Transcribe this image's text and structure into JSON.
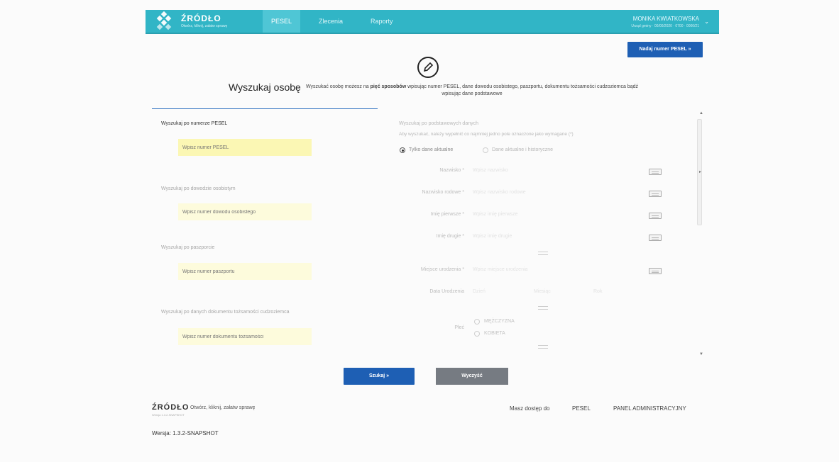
{
  "header": {
    "logo_title": "ŹRÓDŁO",
    "logo_subtitle": "Otwórz, kliknij, załatw sprawę",
    "nav": [
      {
        "label": "PESEL",
        "active": true
      },
      {
        "label": "Zlecenia",
        "active": false
      },
      {
        "label": "Raporty",
        "active": false
      }
    ],
    "user_name": "MONIKA KWIATKOWSKA",
    "user_sub": "Urząd gminy · 00/00/2020 · 0700 · 0000/21"
  },
  "assign_pesel_button": "Nadaj numer PESEL »",
  "search": {
    "title": "Wyszukaj osobę",
    "intro_prefix": "Wyszukać osobę możesz na ",
    "intro_bold": "pięć sposobów",
    "intro_suffix": " wpisując numer PESEL, dane dowodu osobistego, paszportu, dokumentu tożsamości cudzoziemca bądź wpisując dane podstawowe"
  },
  "left_sections": [
    {
      "label": "Wyszukaj po numerze PESEL",
      "placeholder": "Wpisz numer PESEL"
    },
    {
      "label": "Wyszukaj po dowodzie osobistym",
      "placeholder": "Wpisz numer dowodu osobistego"
    },
    {
      "label": "Wyszukaj po paszporcie",
      "placeholder": "Wpisz numer paszportu"
    },
    {
      "label": "Wyszukaj po danych dokumentu tożsamości cudzoziemca",
      "placeholder": "Wpisz numer dokumentu tożsamości"
    }
  ],
  "basic": {
    "title": "Wyszukaj po podstawowych danych",
    "hint": "Aby wyszukać, należy wypełnić co najmniej jedno pole oznaczone jako wymagane (*)",
    "radio_current": "Tylko dane aktualne",
    "radio_history": "Dane aktualne i historyczne",
    "fields": [
      {
        "label": "Nazwisko *",
        "placeholder": "Wpisz nazwisko"
      },
      {
        "label": "Nazwisko rodowe *",
        "placeholder": "Wpisz nazwisko rodowe"
      },
      {
        "label": "Imię pierwsze *",
        "placeholder": "Wpisz imię pierwsze"
      },
      {
        "label": "Imię drugie *",
        "placeholder": "Wpisz imię drugie"
      },
      {
        "label": "Miejsce urodzenia *",
        "placeholder": "Wpisz miejsce urodzenia"
      }
    ],
    "birth_date_label": "Data Urodzenia",
    "birth_day": "Dzień",
    "birth_month": "Miesiąc",
    "birth_year": "Rok",
    "sex_label": "Płeć",
    "sex_male": "MĘŻCZYZNA",
    "sex_female": "KOBIETA"
  },
  "buttons": {
    "search": "Szukaj »",
    "clear": "Wyczyść"
  },
  "footer": {
    "logo": "ŹRÓDŁO",
    "tagline": "Otwórz, kliknij, załatw sprawę",
    "small": "Wersja 1.3.2-SNAPSHOT",
    "access_label": "Masz dostęp do",
    "access_pesel": "PESEL",
    "access_admin": "PANEL ADMINISTRACYJNY",
    "version": "Wersja: 1.3.2-SNAPSHOT"
  },
  "colors": {
    "topbar": "#31b5c6",
    "primary_button": "#1e5fb4",
    "pesel_input": "#fbf7b4",
    "clear_button": "#767b82"
  }
}
